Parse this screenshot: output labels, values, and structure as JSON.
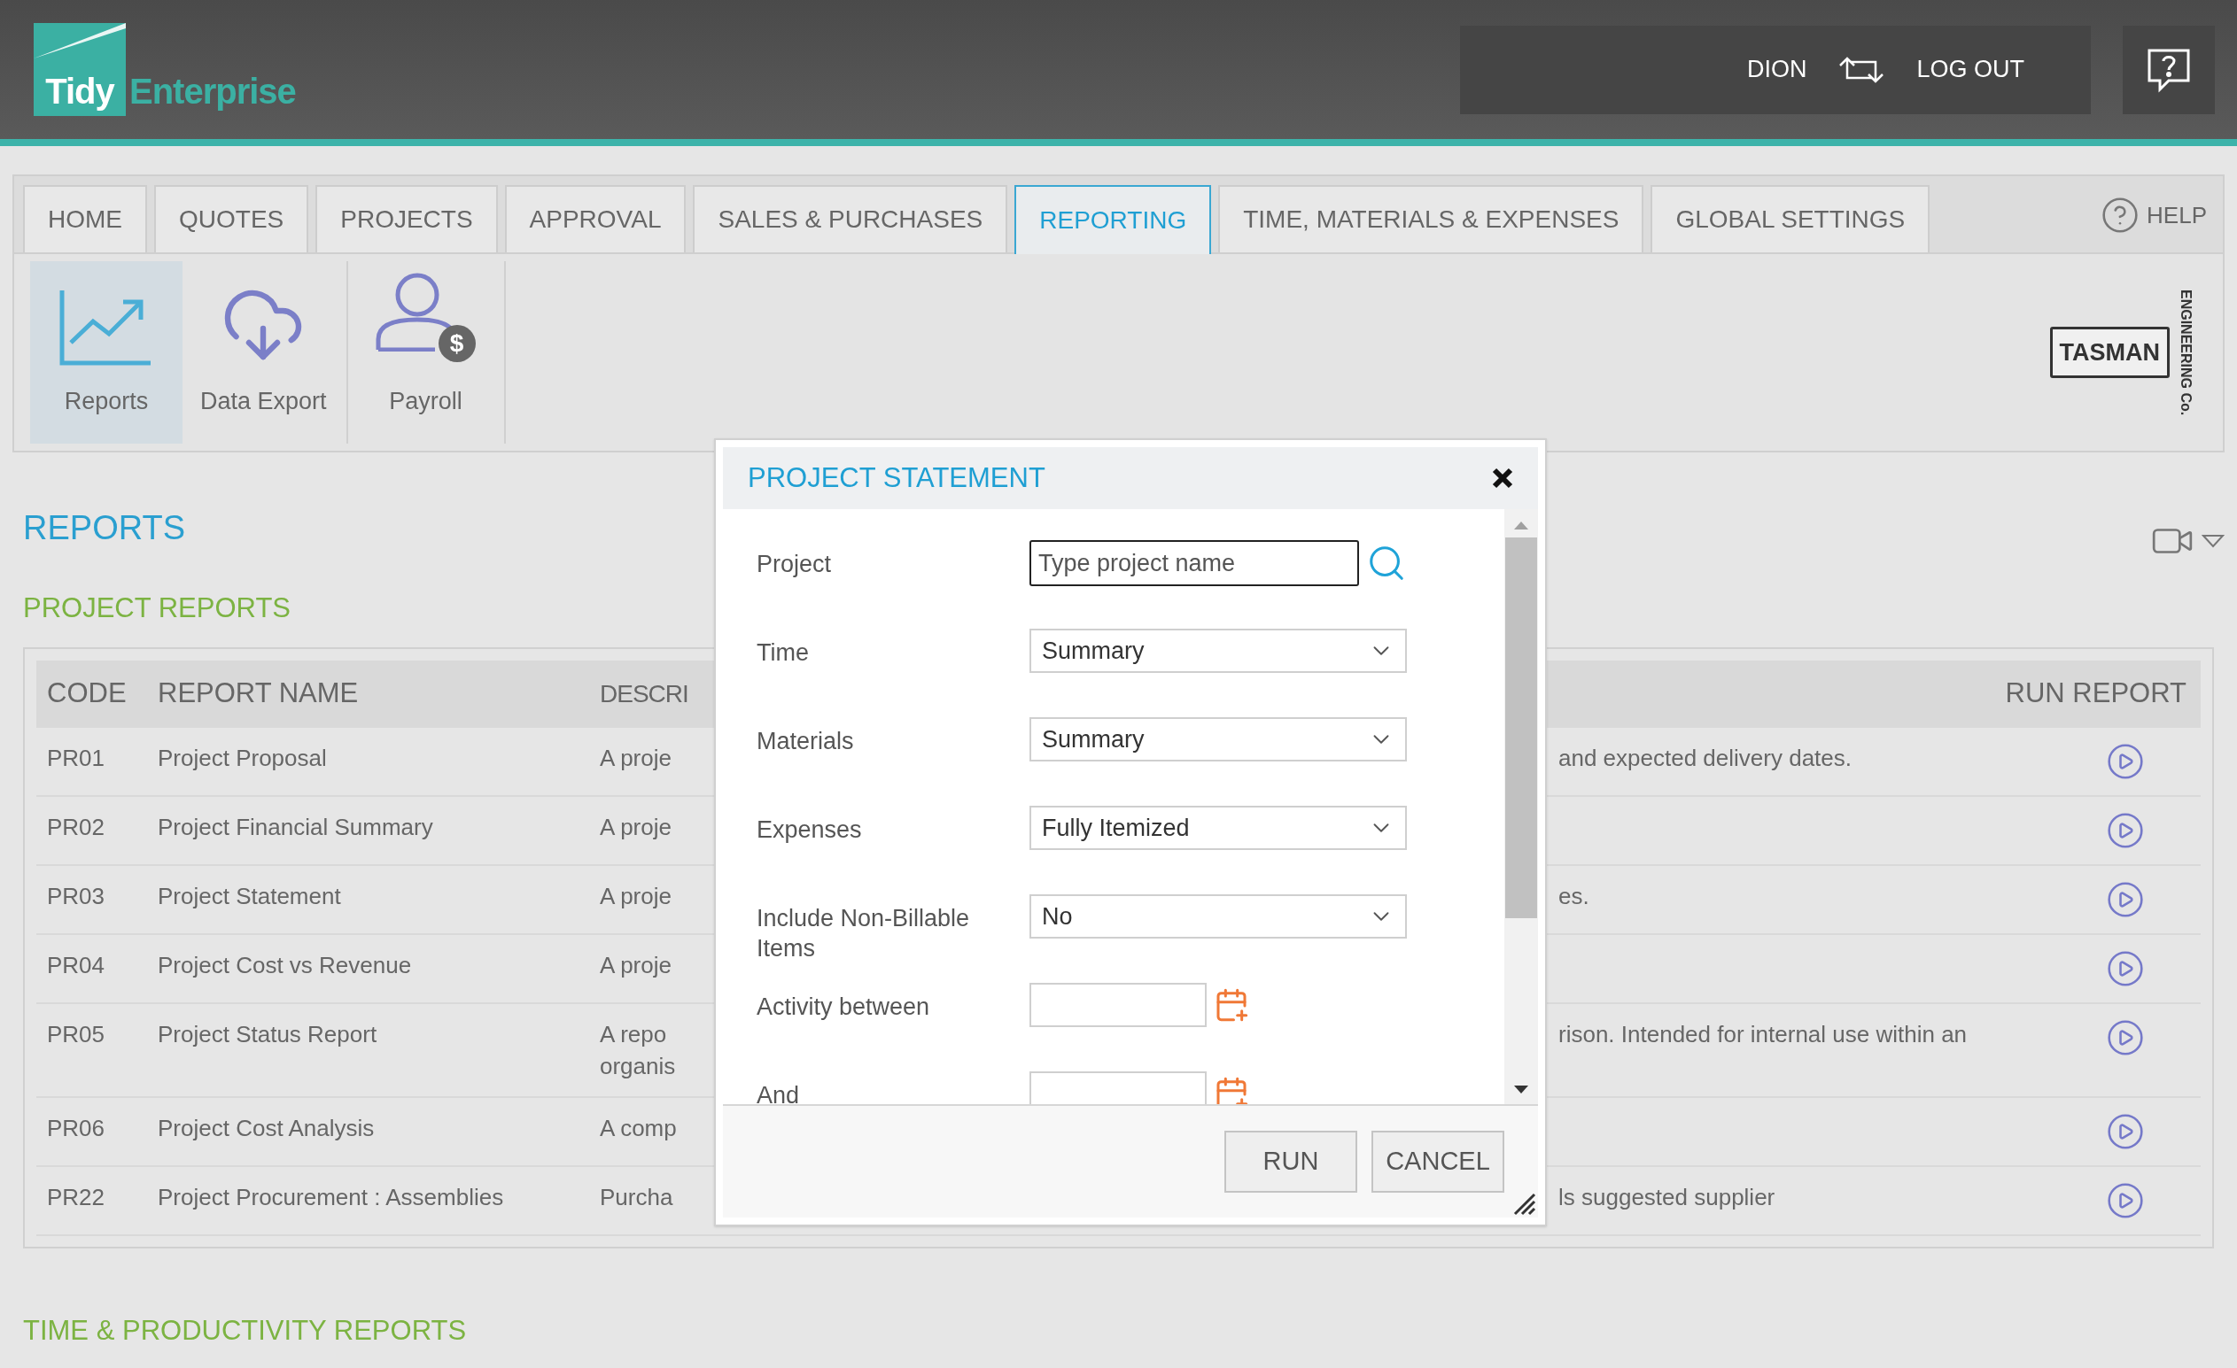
{
  "header": {
    "logo": {
      "word_1": "Tidy",
      "word_2": "Enterprise"
    },
    "user": "DION",
    "logout": "LOG OUT"
  },
  "nav": {
    "tabs": [
      {
        "label": "HOME",
        "selected": false
      },
      {
        "label": "QUOTES",
        "selected": false
      },
      {
        "label": "PROJECTS",
        "selected": false
      },
      {
        "label": "APPROVAL",
        "selected": false
      },
      {
        "label": "SALES & PURCHASES",
        "selected": false
      },
      {
        "label": "REPORTING",
        "selected": true
      },
      {
        "label": "TIME, MATERIALS & EXPENSES",
        "selected": false
      },
      {
        "label": "GLOBAL SETTINGS",
        "selected": false
      }
    ],
    "help": "HELP"
  },
  "toolbar": {
    "items": [
      {
        "label": "Reports",
        "kind": "chart",
        "selected": true
      },
      {
        "label": "Data Export",
        "kind": "cloud",
        "selected": false
      },
      {
        "label": "Payroll",
        "kind": "payroll",
        "badge": "$",
        "selected": false
      }
    ],
    "brand": {
      "name": "TASMAN",
      "tagline": "ENGINEERING Co."
    }
  },
  "page": {
    "title": "REPORTS",
    "section": "PROJECT REPORTS",
    "next_section": "TIME & PRODUCTIVITY REPORTS"
  },
  "table": {
    "columns": [
      "CODE",
      "REPORT NAME",
      "DESCRI",
      "RUN REPORT"
    ],
    "rows": [
      {
        "code": "PR01",
        "name": "Project Proposal",
        "description_start": [
          "A proje"
        ],
        "description_end": "and expected delivery dates."
      },
      {
        "code": "PR02",
        "name": "Project Financial Summary",
        "description_start": [
          "A proje"
        ]
      },
      {
        "code": "PR03",
        "name": "Project Statement",
        "description_start": [
          "A proje"
        ],
        "description_end": "es."
      },
      {
        "code": "PR04",
        "name": "Project Cost vs Revenue",
        "description_start": [
          "A proje"
        ]
      },
      {
        "code": "PR05",
        "name": "Project Status Report",
        "description_start": [
          "A repo",
          "organis"
        ],
        "description_end": "rison. Intended for internal use within an"
      },
      {
        "code": "PR06",
        "name": "Project Cost Analysis",
        "description_start": [
          "A comp"
        ]
      },
      {
        "code": "PR22",
        "name": "Project Procurement : Assemblies",
        "description_start": [
          "Purcha"
        ],
        "description_end": "ls suggested supplier"
      }
    ]
  },
  "dialog": {
    "title": "PROJECT STATEMENT",
    "fields": [
      {
        "kind": "search",
        "label": "Project",
        "placeholder": "Type project name"
      },
      {
        "kind": "select",
        "label": "Time",
        "value": "Summary"
      },
      {
        "kind": "select",
        "label": "Materials",
        "value": "Summary"
      },
      {
        "kind": "select",
        "label": "Expenses",
        "value": "Fully Itemized"
      },
      {
        "kind": "select",
        "label": "Include Non-Billable Items",
        "value": "No"
      },
      {
        "kind": "date",
        "label": "Activity between"
      },
      {
        "kind": "date",
        "label": "And"
      }
    ],
    "buttons": [
      "RUN",
      "CANCEL"
    ]
  }
}
